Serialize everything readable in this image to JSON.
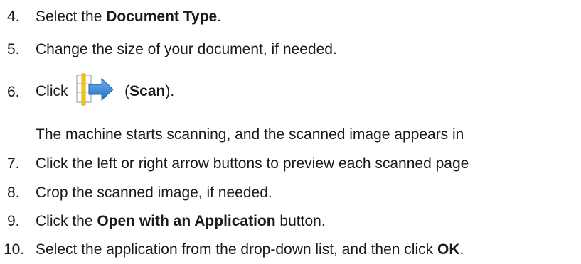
{
  "steps": [
    {
      "num": "4.",
      "pre": "Select the ",
      "bold": "Document Type",
      "post": "."
    },
    {
      "num": "5.",
      "text": "Change the size of your document, if needed."
    },
    {
      "num": "6.",
      "pre": "Click ",
      "icon": "scan-icon",
      "paren_open": " (",
      "bold": "Scan",
      "post": ")."
    },
    {
      "note": "The machine starts scanning, and the scanned image appears in"
    },
    {
      "num": "7.",
      "text": "Click the left or right arrow buttons to preview each scanned page"
    },
    {
      "num": "8.",
      "text": "Crop the scanned image, if needed."
    },
    {
      "num": "9.",
      "pre": "Click the ",
      "bold": "Open with an Application",
      "post": " button."
    },
    {
      "num": "10.",
      "pre": "Select the application from the drop-down list, and then click ",
      "bold": "OK",
      "post": "."
    }
  ]
}
